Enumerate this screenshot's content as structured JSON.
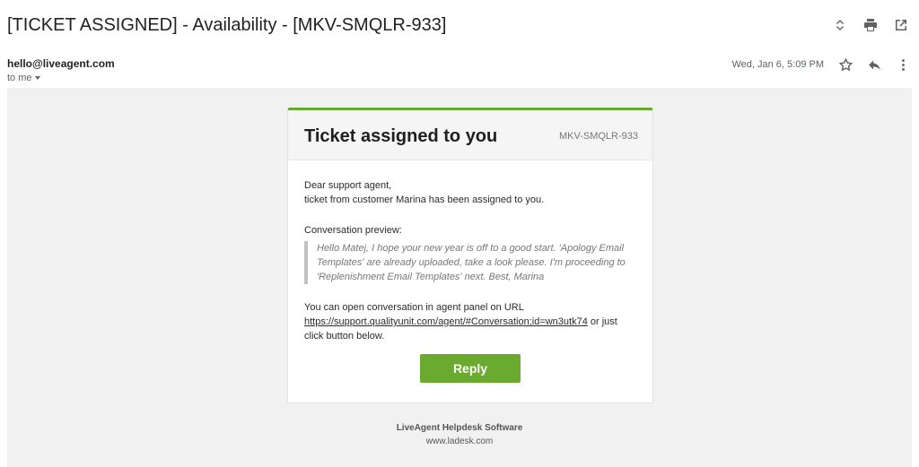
{
  "subject": "[TICKET ASSIGNED] - Availability - [MKV-SMQLR-933]",
  "top_icons": [
    "expand-collapse-icon",
    "print-icon",
    "open-new-window-icon"
  ],
  "sender": {
    "email": "hello@liveagent.com",
    "to": "to me",
    "date": "Wed, Jan 6, 5:09 PM"
  },
  "meta_icons": [
    "star-icon",
    "reply-icon",
    "more-vert-icon"
  ],
  "card": {
    "title": "Ticket assigned to you",
    "ticket_id": "MKV-SMQLR-933",
    "greeting": "Dear support agent,",
    "intro": "ticket from customer Marina has been assigned to you.",
    "preview_label": "Conversation preview:",
    "preview_text": "Hello Matej, I hope your new year is off to a good start.  'Apology Email Templates' are already uploaded, take a look please. I'm proceeding to 'Replenishment Email Templates' next. Best, Marina",
    "open_text": "You can open conversation in agent panel on URL",
    "url": "https://support.qualityunit.com/agent/#Conversation;id=wn3utk74",
    "open_suffix": " or just click button below.",
    "reply_label": "Reply"
  },
  "footer": {
    "title": "LiveAgent Helpdesk Software",
    "url": "www.ladesk.com"
  },
  "colors": {
    "accent_green": "#6aaa2f",
    "background": "#f1f1f1"
  }
}
